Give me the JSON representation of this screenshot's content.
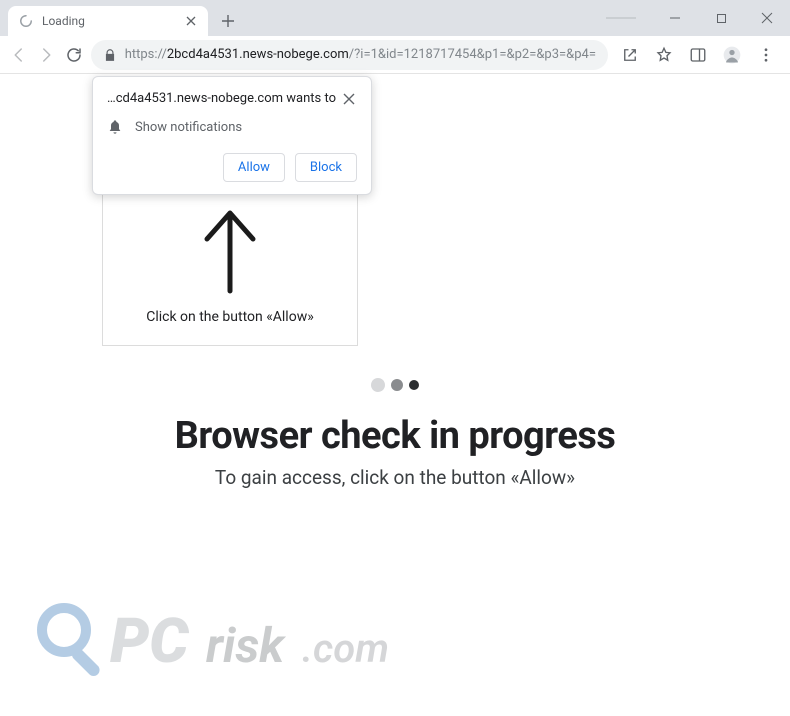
{
  "window": {
    "tab_title": "Loading"
  },
  "toolbar": {
    "url_proto": "https://",
    "url_host": "2bcd4a4531.news-nobege.com",
    "url_rest": "/?i=1&id=1218717454&p1=&p2=&p3=&p4="
  },
  "notification": {
    "origin": "…cd4a4531.news-nobege.com wants to",
    "permission_label": "Show notifications",
    "allow_label": "Allow",
    "block_label": "Block"
  },
  "hint": {
    "text": "Click on the button «Allow»"
  },
  "page": {
    "headline": "Browser check in progress",
    "subline": "To gain access, click on the button «Allow»"
  },
  "watermark": {
    "text": "PCrisk.com"
  }
}
